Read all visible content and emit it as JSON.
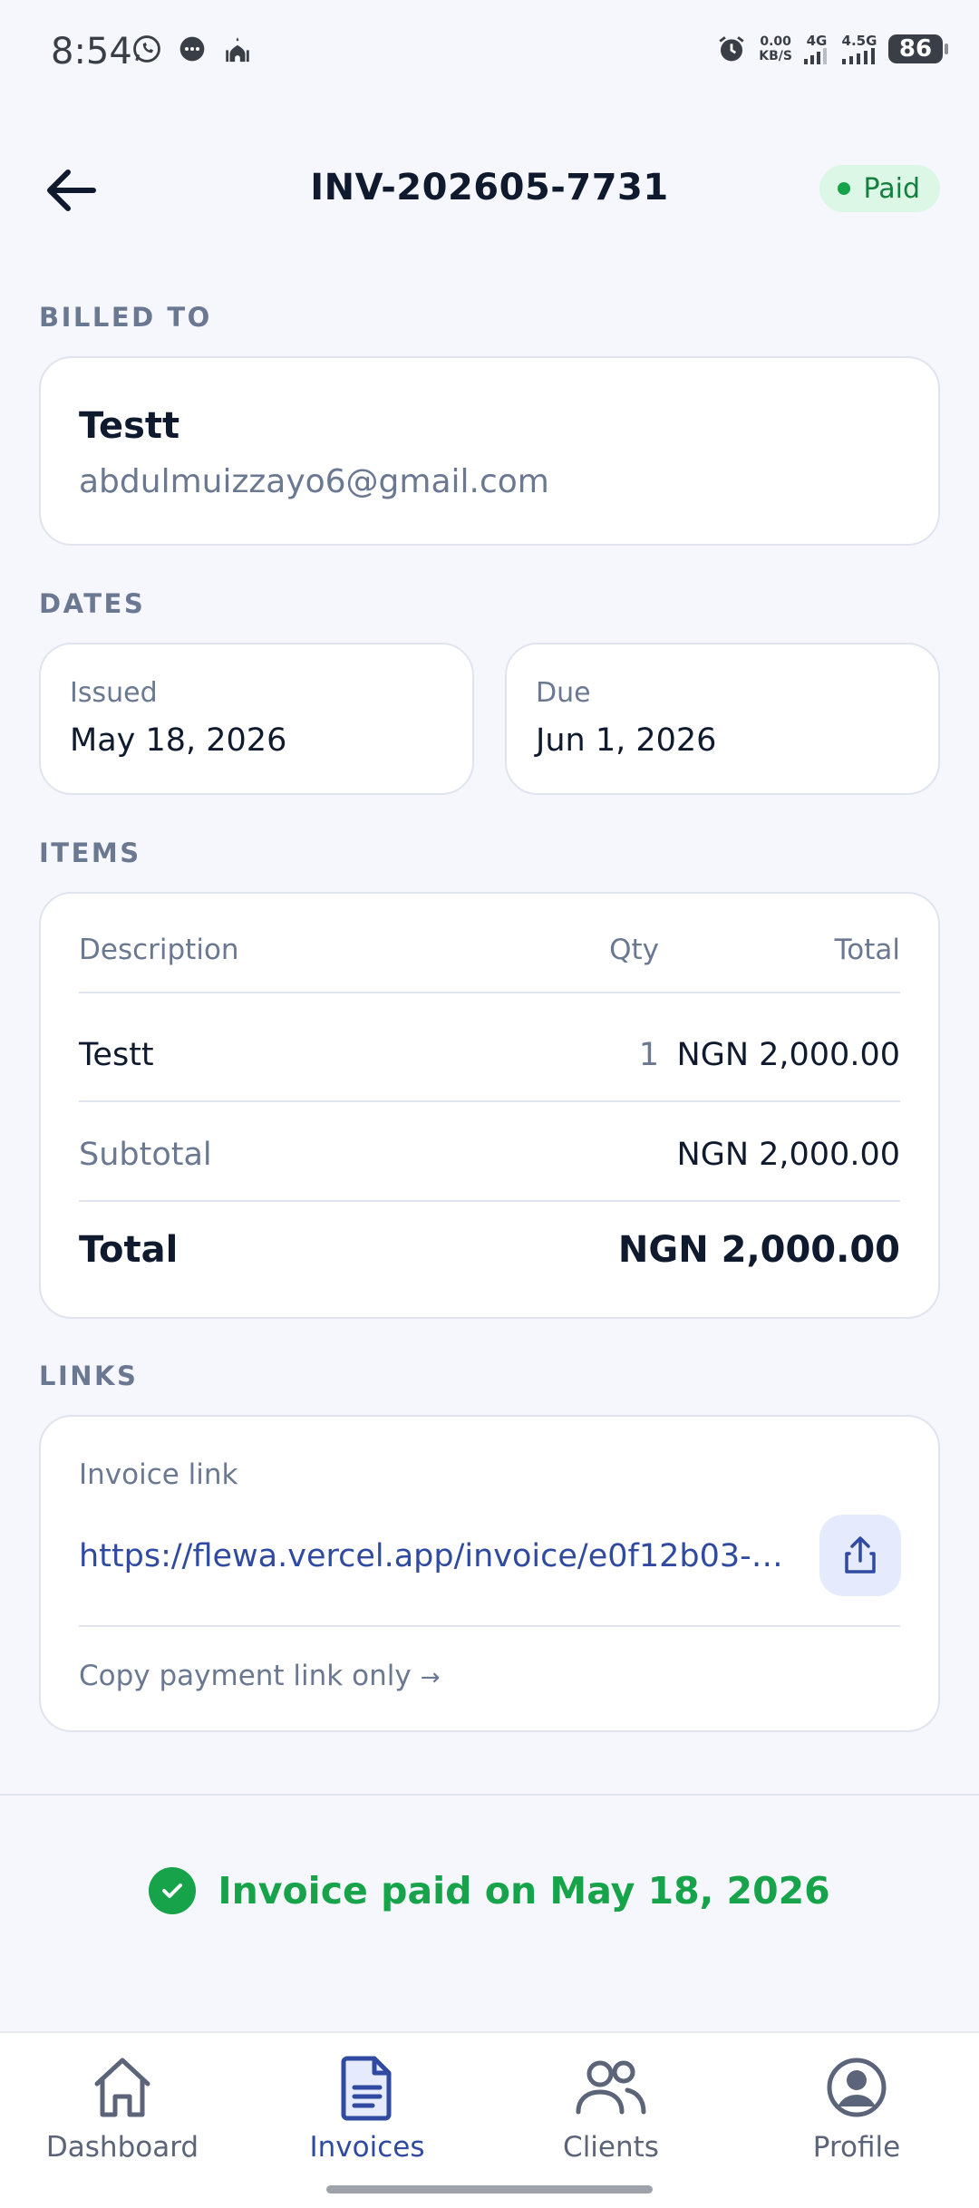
{
  "status_bar": {
    "time": "8:54",
    "netspeed_value": "0.00",
    "netspeed_unit": "KB/S",
    "net1": "4G",
    "net2": "4.5G",
    "battery": "86"
  },
  "header": {
    "title": "INV-202605-7731",
    "status": "Paid",
    "status_color": "#16a34a"
  },
  "billed_to": {
    "label": "BILLED TO",
    "name": "Testt",
    "email": "abdulmuizzayo6@gmail.com"
  },
  "dates": {
    "label": "DATES",
    "issued_label": "Issued",
    "issued_value": "May 18, 2026",
    "due_label": "Due",
    "due_value": "Jun 1, 2026"
  },
  "items": {
    "label": "ITEMS",
    "columns": {
      "description": "Description",
      "qty": "Qty",
      "total": "Total"
    },
    "rows": [
      {
        "description": "Testt",
        "qty": "1",
        "total": "NGN 2,000.00"
      }
    ],
    "subtotal_label": "Subtotal",
    "subtotal_value": "NGN 2,000.00",
    "total_label": "Total",
    "total_value": "NGN 2,000.00"
  },
  "links": {
    "label": "LINKS",
    "invoice_link_label": "Invoice link",
    "invoice_link_url": "https://flewa.vercel.app/invoice/e0f12b03-6...",
    "copy_payment_label": "Copy payment link only",
    "copy_arrow": "→"
  },
  "paid_banner": {
    "text": "Invoice paid on May 18, 2026"
  },
  "bottom_nav": {
    "items": [
      {
        "label": "Dashboard",
        "icon": "home-icon"
      },
      {
        "label": "Invoices",
        "icon": "document-icon"
      },
      {
        "label": "Clients",
        "icon": "users-icon"
      },
      {
        "label": "Profile",
        "icon": "user-circle-icon"
      }
    ],
    "active": "Invoices",
    "accent": "#2f4aa0"
  }
}
